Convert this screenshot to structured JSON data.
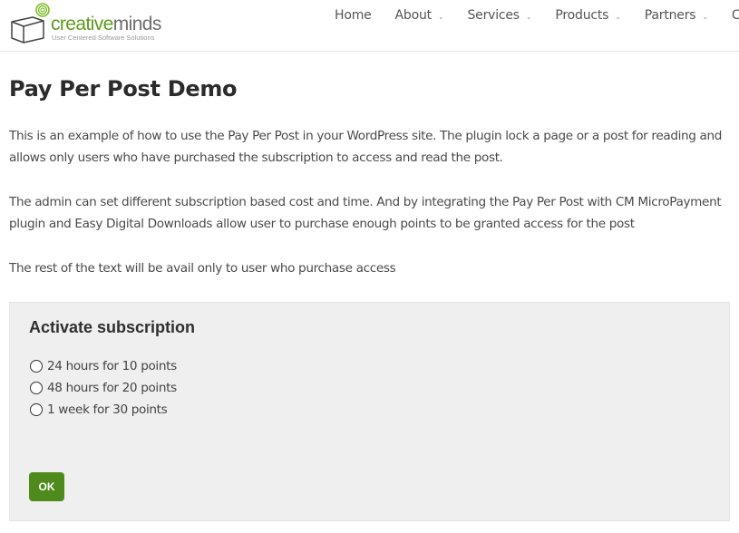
{
  "header": {
    "logo": {
      "word_part1": "creative",
      "word_part2": "minds",
      "tagline": "User Centered Software Solutions",
      "accent_color": "#5e9b1e"
    },
    "nav": [
      {
        "label": "Home",
        "has_dropdown": false
      },
      {
        "label": "About",
        "has_dropdown": true
      },
      {
        "label": "Services",
        "has_dropdown": true
      },
      {
        "label": "Products",
        "has_dropdown": true
      },
      {
        "label": "Partners",
        "has_dropdown": true
      },
      {
        "label": "Cu",
        "has_dropdown": false
      }
    ],
    "dropdown_glyph": "⌄"
  },
  "main": {
    "title": "Pay Per Post Demo",
    "paragraphs": [
      "This is an example of how to use the Pay Per Post in your WordPress site. The plugin lock a page or a post for reading and allows only users who have purchased the subscription to access and read the post.",
      "The admin can set different subscription based cost and time. And by integrating the Pay Per Post with CM MicroPayment plugin and Easy Digital Downloads allow user to purchase enough points to be granted access for the post",
      "The rest of the text will be avail only to user who purchase access"
    ]
  },
  "subscription": {
    "title": "Activate subscription",
    "options": [
      {
        "label": "24 hours for 10 points",
        "selected": false
      },
      {
        "label": "48 hours for 20 points",
        "selected": false
      },
      {
        "label": "1 week for 30 points",
        "selected": false
      }
    ],
    "ok_label": "OK",
    "button_color": "#4f8a1c"
  }
}
